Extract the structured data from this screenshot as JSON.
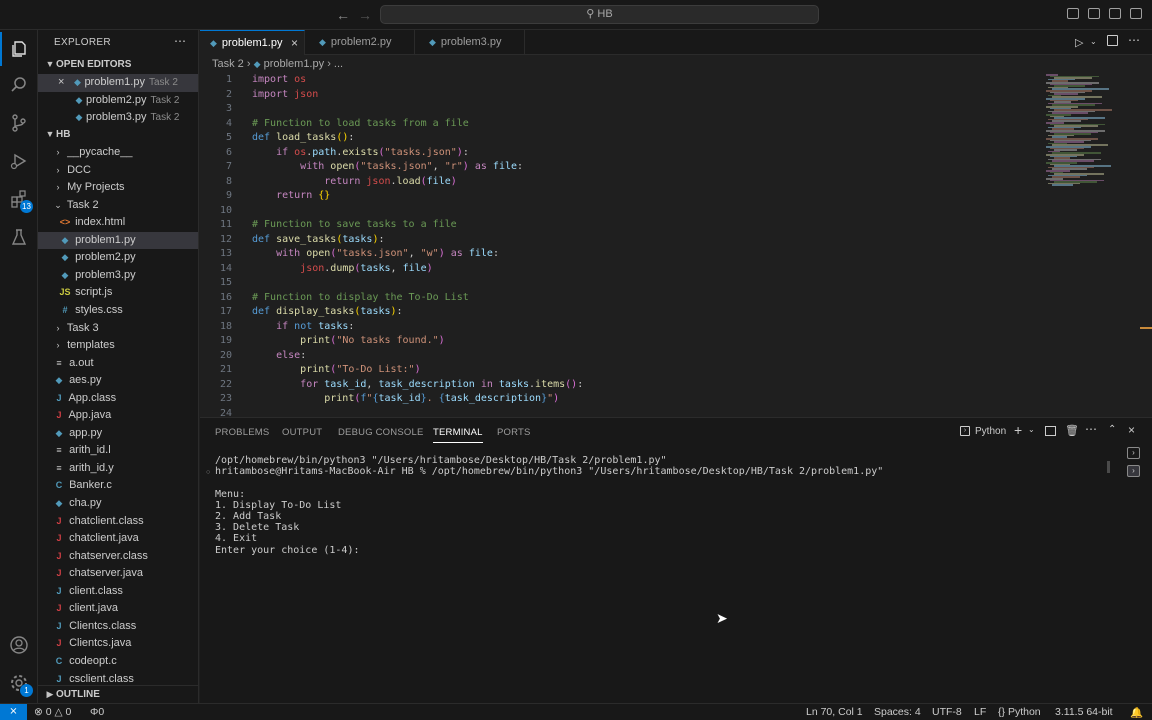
{
  "titlebar": {
    "search_text": "HB"
  },
  "activity_badges": {
    "extensions": "13",
    "manage": "1"
  },
  "sidebar": {
    "title": "EXPLORER",
    "open_editors_label": "OPEN EDITORS",
    "open_editors": [
      {
        "name": "problem1.py",
        "desc": "Task 2"
      },
      {
        "name": "problem2.py",
        "desc": "Task 2"
      },
      {
        "name": "problem3.py",
        "desc": "Task 2"
      }
    ],
    "folder_label": "HB",
    "tree": [
      {
        "name": "__pycache__",
        "type": "folder-closed"
      },
      {
        "name": "DCC",
        "type": "folder-closed"
      },
      {
        "name": "My Projects",
        "type": "folder-closed"
      },
      {
        "name": "Task 2",
        "type": "folder-open"
      },
      {
        "name": "index.html",
        "type": "html"
      },
      {
        "name": "problem1.py",
        "type": "py"
      },
      {
        "name": "problem2.py",
        "type": "py"
      },
      {
        "name": "problem3.py",
        "type": "py"
      },
      {
        "name": "script.js",
        "type": "js"
      },
      {
        "name": "styles.css",
        "type": "css"
      },
      {
        "name": "Task 3",
        "type": "folder-closed"
      },
      {
        "name": "templates",
        "type": "folder-closed"
      },
      {
        "name": "a.out",
        "type": "txt"
      },
      {
        "name": "aes.py",
        "type": "py"
      },
      {
        "name": "App.class",
        "type": "java"
      },
      {
        "name": "App.java",
        "type": "javaf"
      },
      {
        "name": "app.py",
        "type": "py"
      },
      {
        "name": "arith_id.l",
        "type": "txt"
      },
      {
        "name": "arith_id.y",
        "type": "txt"
      },
      {
        "name": "Banker.c",
        "type": "c"
      },
      {
        "name": "cha.py",
        "type": "py"
      },
      {
        "name": "chatclient.class",
        "type": "javaf"
      },
      {
        "name": "chatclient.java",
        "type": "javaf"
      },
      {
        "name": "chatserver.class",
        "type": "javaf"
      },
      {
        "name": "chatserver.java",
        "type": "javaf"
      },
      {
        "name": "client.class",
        "type": "java"
      },
      {
        "name": "client.java",
        "type": "javaf"
      },
      {
        "name": "Clientcs.class",
        "type": "java"
      },
      {
        "name": "Clientcs.java",
        "type": "javaf"
      },
      {
        "name": "codeopt.c",
        "type": "c"
      },
      {
        "name": "csclient.class",
        "type": "java"
      }
    ],
    "outline_label": "OUTLINE"
  },
  "tabs": [
    {
      "label": "problem1.py"
    },
    {
      "label": "problem2.py"
    },
    {
      "label": "problem3.py"
    }
  ],
  "breadcrumb": {
    "folder": "Task 2",
    "file": "problem1.py",
    "more": "..."
  },
  "editor": {
    "line_numbers": [
      "1",
      "2",
      "3",
      "4",
      "5",
      "6",
      "7",
      "8",
      "9",
      "10",
      "11",
      "12",
      "13",
      "14",
      "15",
      "16",
      "17",
      "18",
      "19",
      "20",
      "21",
      "22",
      "23",
      "24"
    ]
  },
  "panel": {
    "tabs": [
      "PROBLEMS",
      "OUTPUT",
      "DEBUG CONSOLE",
      "TERMINAL",
      "PORTS"
    ],
    "shell_label": "Python",
    "terminal_lines": [
      "/opt/homebrew/bin/python3 \"/Users/hritambose/Desktop/HB/Task 2/problem1.py\"",
      "hritambose@Hritams-MacBook-Air HB % /opt/homebrew/bin/python3 \"/Users/hritambose/Desktop/HB/Task 2/problem1.py\"",
      "",
      "Menu:",
      "1. Display To-Do List",
      "2. Add Task",
      "3. Delete Task",
      "4. Exit",
      "Enter your choice (1-4): "
    ]
  },
  "statusbar": {
    "errors": "0",
    "warnings": "0",
    "ports": "0",
    "position": "Ln 70, Col 1",
    "spaces": "Spaces: 4",
    "encoding": "UTF-8",
    "eol": "LF",
    "language": "Python",
    "interpreter": "3.11.5 64-bit"
  },
  "colors": {
    "accent": "#0078d4",
    "background": "#1f1f1f",
    "sidebar": "#181818"
  }
}
